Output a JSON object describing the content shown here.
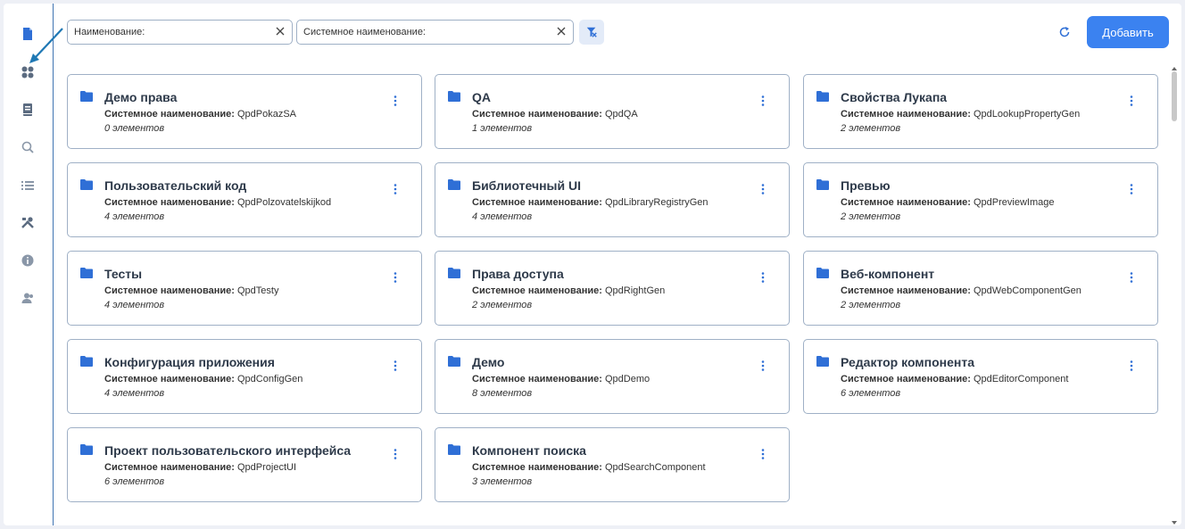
{
  "sidebar": {
    "items": [
      {
        "icon": "document-icon"
      },
      {
        "icon": "grid-icon"
      },
      {
        "icon": "book-icon"
      },
      {
        "icon": "search-icon"
      },
      {
        "icon": "list-icon"
      },
      {
        "icon": "tools-icon"
      },
      {
        "icon": "info-icon"
      },
      {
        "icon": "user-icon"
      }
    ]
  },
  "filters": {
    "name_label": "Наименование:",
    "system_name_label": "Системное наименование:"
  },
  "toolbar": {
    "add_label": "Добавить"
  },
  "card_sys_label": "Системное наименование:",
  "cards": [
    {
      "title": "Демо права",
      "system_name": "QpdPokazSA",
      "count": "0 элементов"
    },
    {
      "title": "QA",
      "system_name": "QpdQA",
      "count": "1 элементов"
    },
    {
      "title": "Свойства Лукапа",
      "system_name": "QpdLookupPropertyGen",
      "count": "2 элементов"
    },
    {
      "title": "Пользовательский код",
      "system_name": "QpdPolzovatelskijkod",
      "count": "4 элементов"
    },
    {
      "title": "Библиотечный UI",
      "system_name": "QpdLibraryRegistryGen",
      "count": "4 элементов"
    },
    {
      "title": "Превью",
      "system_name": "QpdPreviewImage",
      "count": "2 элементов"
    },
    {
      "title": "Тесты",
      "system_name": "QpdTesty",
      "count": "4 элементов"
    },
    {
      "title": "Права доступа",
      "system_name": "QpdRightGen",
      "count": "2 элементов"
    },
    {
      "title": "Веб-компонент",
      "system_name": "QpdWebComponentGen",
      "count": "2 элементов"
    },
    {
      "title": "Конфигурация приложения",
      "system_name": "QpdConfigGen",
      "count": "4 элементов"
    },
    {
      "title": "Демо",
      "system_name": "QpdDemo",
      "count": "8 элементов"
    },
    {
      "title": "Редактор компонента",
      "system_name": "QpdEditorComponent",
      "count": "6 элементов"
    },
    {
      "title": "Проект пользовательского интерфейса",
      "system_name": "QpdProjectUI",
      "count": "6 элементов"
    },
    {
      "title": "Компонент поиска",
      "system_name": "QpdSearchComponent",
      "count": "3 элементов"
    }
  ],
  "colors": {
    "accent": "#3b82f0",
    "icon_blue": "#2f6fd6",
    "border": "#9fb0c6"
  }
}
